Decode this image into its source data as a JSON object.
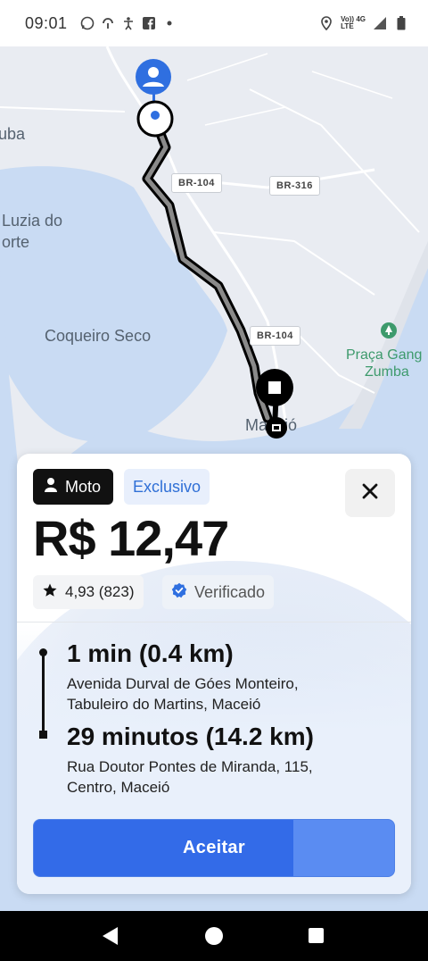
{
  "status_bar": {
    "time": "09:01",
    "left_icons": [
      "whatsapp-icon",
      "hook-icon",
      "accessibility-icon",
      "facebook-icon",
      "dot-icon"
    ],
    "network_top": "Vo)) 4G",
    "network_bottom": "LTE"
  },
  "map": {
    "labels": {
      "uba": "uba",
      "luzia_line1": "Luzia do",
      "luzia_line2": "orte",
      "coqueiro": "Coqueiro Seco",
      "maceio": "Maceió",
      "praca_line1": "Praça Gang",
      "praca_line2": "Zumba"
    },
    "roads": {
      "br104_top": "BR-104",
      "br316": "BR-316",
      "br104_bottom": "BR-104"
    },
    "colors": {
      "water": "#c9dbf3",
      "land": "#e9ecf2",
      "route_outline": "#000000",
      "route_fill": "#8a8a8a",
      "pin": "#2f6fe0"
    }
  },
  "offer": {
    "vehicle": "Moto",
    "tag": "Exclusivo",
    "price": "R$ 12,47",
    "rating": "4,93 (823)",
    "verified": "Verificado",
    "pickup": {
      "eta": "1 min (0.4 km)",
      "address_line1": "Avenida Durval de Góes Monteiro,",
      "address_line2": "Tabuleiro do Martins, Maceió"
    },
    "dropoff": {
      "eta": "29 minutos (14.2 km)",
      "address_line1": "Rua Doutor Pontes de Miranda, 115,",
      "address_line2": "Centro, Maceió"
    },
    "accept_label": "Aceitar",
    "accept_countdown_fraction": 0.72,
    "accent_color": "#336be8"
  },
  "nav_bar": {
    "buttons": [
      "back-icon",
      "home-icon",
      "recent-apps-icon"
    ]
  }
}
